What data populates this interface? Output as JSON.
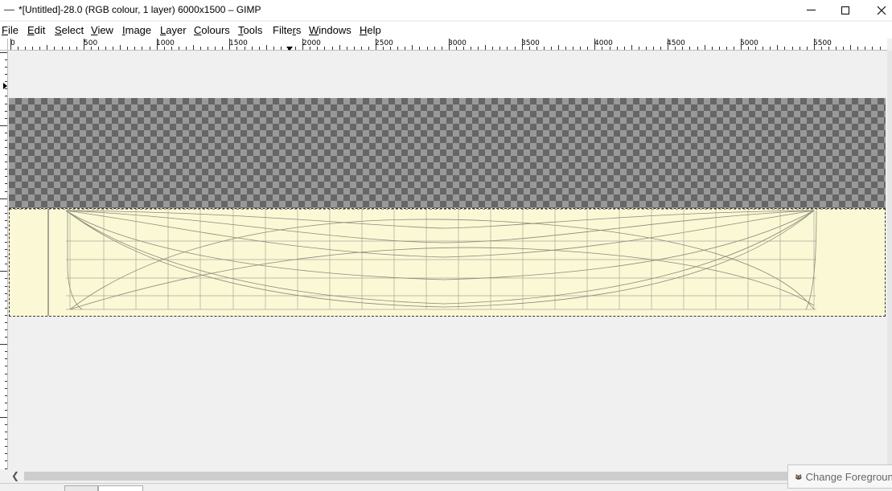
{
  "window": {
    "title": "*[Untitled]-28.0 (RGB colour, 1 layer) 6000x1500 – GIMP"
  },
  "menubar": {
    "items": [
      {
        "pre": "",
        "ul": "F",
        "post": "ile"
      },
      {
        "pre": "",
        "ul": "E",
        "post": "dit"
      },
      {
        "pre": "",
        "ul": "S",
        "post": "elect"
      },
      {
        "pre": "",
        "ul": "V",
        "post": "iew"
      },
      {
        "pre": "",
        "ul": "I",
        "post": "mage"
      },
      {
        "pre": "",
        "ul": "L",
        "post": "ayer"
      },
      {
        "pre": "",
        "ul": "C",
        "post": "olours"
      },
      {
        "pre": "",
        "ul": "T",
        "post": "ools"
      },
      {
        "pre": "Filte",
        "ul": "r",
        "post": "s"
      },
      {
        "pre": "",
        "ul": "W",
        "post": "indows"
      },
      {
        "pre": "",
        "ul": "H",
        "post": "elp"
      }
    ]
  },
  "ruler": {
    "labels": [
      "0",
      "500",
      "1000",
      "1500",
      "2000",
      "2500",
      "3000",
      "3500",
      "4000",
      "4500",
      "5000",
      "5500"
    ]
  },
  "status_popup": {
    "text": "Change Foreground"
  },
  "icons": {
    "minimize": "minimize-icon",
    "maximize": "maximize-icon",
    "close": "close-icon",
    "scroll_left": "chevron-left-icon",
    "wilber": "gimp-wilber-icon"
  }
}
